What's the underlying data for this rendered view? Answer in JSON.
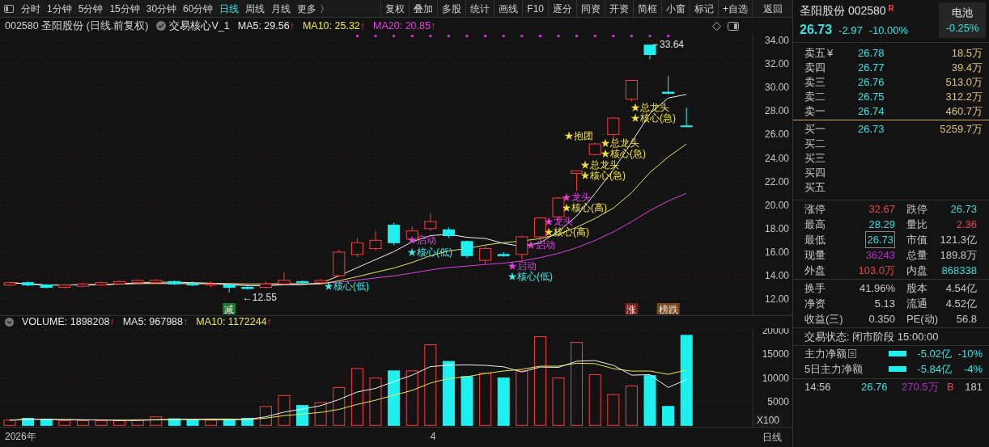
{
  "toolbar": {
    "periods": [
      {
        "label": "分时",
        "selected": false
      },
      {
        "label": "1分钟",
        "selected": false
      },
      {
        "label": "5分钟",
        "selected": false
      },
      {
        "label": "15分钟",
        "selected": false
      },
      {
        "label": "30分钟",
        "selected": false
      },
      {
        "label": "60分钟",
        "selected": false
      },
      {
        "label": "日线",
        "selected": true
      },
      {
        "label": "周线",
        "selected": false
      },
      {
        "label": "月线",
        "selected": false
      },
      {
        "label": "更多 〉",
        "selected": false
      }
    ],
    "buttons": [
      "复权",
      "叠加",
      "多股",
      "统计",
      "画线",
      "F10",
      "逐分",
      "同资",
      "开资",
      "简框",
      "小窗",
      "标记",
      "+自选"
    ],
    "back": "返回"
  },
  "chart_header": {
    "title": "002580 圣阳股份 (日线.前复权)",
    "indicator": "交易核心V_1",
    "averages": [
      {
        "label": "MA5: 29.56",
        "arrow": "↑",
        "color": "#e8e8e8"
      },
      {
        "label": "MA10: 25.32",
        "arrow": "↑",
        "color": "#e8e85a"
      },
      {
        "label": "MA20: 20.85",
        "arrow": "↑",
        "color": "#e040e0"
      }
    ]
  },
  "price_chart": {
    "yticks": [
      "34.00",
      "32.00",
      "30.00",
      "28.00",
      "26.00",
      "24.00",
      "22.00",
      "20.00",
      "18.00",
      "16.00",
      "14.00",
      "12.00"
    ],
    "high_label": "33.64",
    "low_label": "←12.55",
    "markers": [
      {
        "text": "★总龙头",
        "color": "#f0e040"
      },
      {
        "text": "★核心(急)",
        "color": "#f0e040"
      },
      {
        "text": "★抱团",
        "color": "#f0e040"
      },
      {
        "text": "★总龙头",
        "color": "#f0e040"
      },
      {
        "text": "★核心(急)",
        "color": "#f0e040"
      },
      {
        "text": "★总龙头",
        "color": "#f0e040"
      },
      {
        "text": "★核心(急)",
        "color": "#f0e040"
      },
      {
        "text": "★龙头",
        "color": "#e040e0"
      },
      {
        "text": "★核心(高)",
        "color": "#f0e040"
      },
      {
        "text": "★龙头",
        "color": "#e040e0"
      },
      {
        "text": "★核心(高)",
        "color": "#f0e040"
      },
      {
        "text": "★启动",
        "color": "#e040e0"
      },
      {
        "text": "★启动",
        "color": "#e040e0"
      },
      {
        "text": "★核心(低)",
        "color": "#40e8e8"
      },
      {
        "text": "★启动",
        "color": "#e040e0"
      },
      {
        "text": "★核心(低)",
        "color": "#40e8e8"
      },
      {
        "text": "★核心(低)",
        "color": "#40e8e8"
      }
    ],
    "signals": [
      {
        "text": "减",
        "color": "#1d7a2c"
      },
      {
        "text": "涨",
        "color": "#7a1d1d"
      },
      {
        "text": "榜跌",
        "color": "#7a4a1d"
      }
    ]
  },
  "volume": {
    "header": [
      {
        "label": "VOLUME: 1898208",
        "arrow": "↑",
        "color": "#e8e8e8"
      },
      {
        "label": "MA5: 967988",
        "arrow": "↑",
        "color": "#e8e8e8"
      },
      {
        "label": "MA10: 1172244",
        "arrow": "↑",
        "color": "#e8e85a"
      }
    ],
    "yticks": [
      "20000",
      "15000",
      "10000",
      "5000"
    ],
    "unit": "X100"
  },
  "x_axis": {
    "labels": [
      "2026年",
      "4"
    ],
    "period": "日线"
  },
  "quote": {
    "name": "圣阳股份 002580",
    "badge": "R",
    "price": "26.73",
    "change": "-2.97",
    "percent": "-10.00%",
    "sector": {
      "label": "电池",
      "change": "-0.25%"
    }
  },
  "order_book": {
    "currency": "¥",
    "asks": [
      {
        "label": "卖五",
        "price": "26.78",
        "volume": "18.5万"
      },
      {
        "label": "卖四",
        "price": "26.77",
        "volume": "39.4万"
      },
      {
        "label": "卖三",
        "price": "26.76",
        "volume": "513.0万"
      },
      {
        "label": "卖二",
        "price": "26.75",
        "volume": "312.2万"
      },
      {
        "label": "卖一",
        "price": "26.74",
        "volume": "460.7万"
      }
    ],
    "bids": [
      {
        "label": "买一",
        "price": "26.73",
        "volume": "5259.7万"
      },
      {
        "label": "买二"
      },
      {
        "label": "买三"
      },
      {
        "label": "买四"
      },
      {
        "label": "买五"
      }
    ]
  },
  "stats": [
    [
      [
        {
          "label": "涨停",
          "value": "32.67",
          "color": "#e84848",
          "highlighted": false
        },
        {
          "label": "跌停",
          "value": "26.73",
          "color": "#40d8d8",
          "highlighted": false
        }
      ],
      [
        {
          "label": "最高",
          "value": "28.29",
          "color": "#40d8d8",
          "highlighted": false
        },
        {
          "label": "量比",
          "value": "2.36",
          "color": "#e84848",
          "highlighted": false
        }
      ],
      [
        {
          "label": "最低",
          "value": "26.73",
          "color": "#40d8d8",
          "highlighted": true
        },
        {
          "label": "市值",
          "value": "121.3亿",
          "color": "#c8c8c8",
          "highlighted": false
        }
      ],
      [
        {
          "label": "现量",
          "value": "36243",
          "color": "#b030c0",
          "highlighted": false
        },
        {
          "label": "总量",
          "value": "189.8万",
          "color": "#c8c8c8",
          "highlighted": false
        }
      ],
      [
        {
          "label": "外盘",
          "value": "103.0万",
          "color": "#e84848",
          "highlighted": false
        },
        {
          "label": "内盘",
          "value": "868338",
          "color": "#40d8d8",
          "highlighted": false
        }
      ]
    ],
    [
      [
        {
          "label": "换手",
          "value": "41.96%",
          "color": "#c8c8c8",
          "highlighted": false
        },
        {
          "label": "股本",
          "value": "4.54亿",
          "color": "#c8c8c8",
          "highlighted": false
        }
      ],
      [
        {
          "label": "净资",
          "value": "5.13",
          "color": "#c8c8c8",
          "highlighted": false
        },
        {
          "label": "流通",
          "value": "4.52亿",
          "color": "#c8c8c8",
          "highlighted": false
        }
      ],
      [
        {
          "label": "收益(三)",
          "value": "0.350",
          "color": "#c8c8c8",
          "highlighted": false
        },
        {
          "label": "PE(动)",
          "value": "56.8",
          "color": "#c8c8c8",
          "highlighted": false
        }
      ]
    ]
  ],
  "trade_status": "交易状态: 闭市阶段 15:00:00",
  "fund_flow": [
    {
      "label": "主力净额",
      "kind": "with_menu",
      "amount": "-5.02亿",
      "percent": "-10%"
    },
    {
      "label": "5日主力净额",
      "kind": "plain",
      "amount": "-5.84亿",
      "percent": "-4%"
    }
  ],
  "ticks": [
    {
      "time": "14:56",
      "price": "26.76",
      "volume": "270.5万",
      "side": "B",
      "count": "181"
    }
  ]
}
